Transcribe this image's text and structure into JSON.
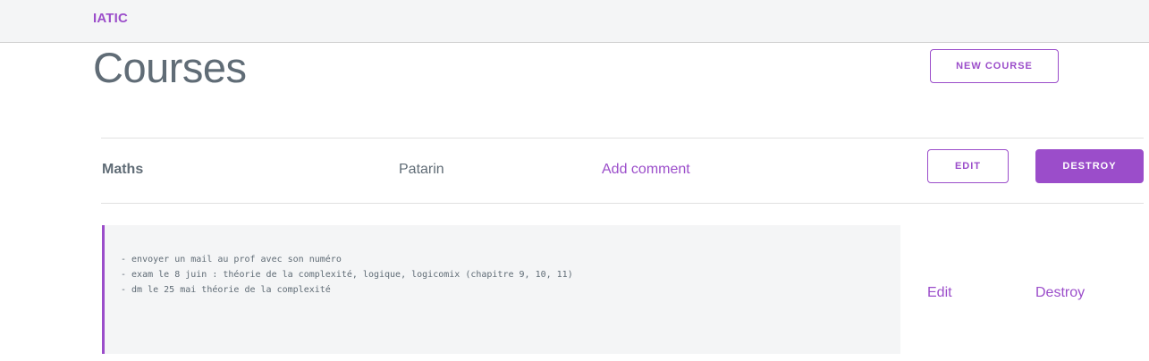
{
  "navbar": {
    "brand": "IATIC"
  },
  "page": {
    "title": "Courses",
    "new_course_label": "NEW COURSE"
  },
  "courses": [
    {
      "name": "Maths",
      "teacher": "Patarin",
      "add_comment_label": "Add comment",
      "edit_label": "EDIT",
      "destroy_label": "DESTROY",
      "comments": [
        {
          "lines": [
            "- envoyer un mail au prof avec son numéro",
            "- exam le 8 juin : théorie de la complexité, logique, logicomix (chapitre 9, 10, 11)",
            "- dm le 25 mai théorie de la complexité"
          ],
          "edit_label": "Edit",
          "destroy_label": "Destroy"
        }
      ]
    }
  ],
  "colors": {
    "accent": "#9b4dca",
    "text": "#606c76",
    "panel": "#f4f5f6"
  }
}
